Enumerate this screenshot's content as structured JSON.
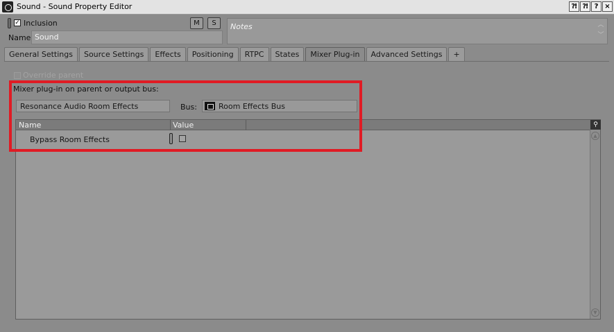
{
  "window": {
    "title": "Sound - Sound Property Editor",
    "title_buttons": [
      "⁈",
      "⁈",
      "?",
      "×"
    ]
  },
  "header": {
    "inclusion_label": "Inclusion",
    "inclusion_checked": true,
    "mute_label": "M",
    "solo_label": "S",
    "name_label": "Name",
    "name_value": "Sound",
    "notes_placeholder": "Notes"
  },
  "tabs": [
    {
      "label": "General Settings"
    },
    {
      "label": "Source Settings"
    },
    {
      "label": "Effects"
    },
    {
      "label": "Positioning"
    },
    {
      "label": "RTPC"
    },
    {
      "label": "States"
    },
    {
      "label": "Mixer Plug-in",
      "active": true
    },
    {
      "label": "Advanced Settings"
    },
    {
      "label": "+"
    }
  ],
  "mixer": {
    "override_label": "Override parent",
    "override_checked": false,
    "section_label": "Mixer plug-in on parent or output bus:",
    "plugin_value": "Resonance Audio Room Effects",
    "bus_label": "Bus:",
    "bus_value": "Room Effects Bus",
    "bus_icon": "bus-icon"
  },
  "grid": {
    "columns": [
      "Name",
      "Value"
    ],
    "rows": [
      {
        "name": "Bypass Room Effects",
        "value": false
      }
    ]
  },
  "colors": {
    "highlight": "#e01b24",
    "panel_bg": "#8b8b8b"
  }
}
